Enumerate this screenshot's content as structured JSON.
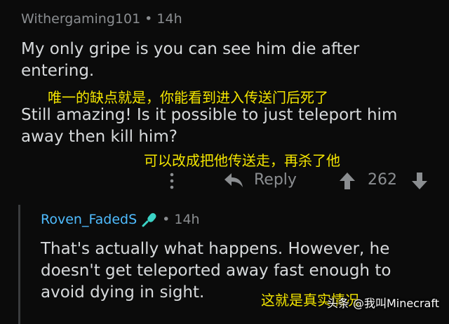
{
  "comment": {
    "author": "Withergaming101",
    "separator": "•",
    "time": "14h",
    "lines": [
      "My only gripe is you can see him die after",
      "entering.",
      "Still amazing! Is it possible to just teleport him",
      "away then kill him?"
    ],
    "overlay_1": "唯一的缺点就是，你能看到进入传送门后死了",
    "overlay_2": "可以改成把他传送走，再杀了他",
    "actions": {
      "reply_label": "Reply",
      "vote_count": "262"
    }
  },
  "reply": {
    "author": "Roven_FadedS",
    "separator": "•",
    "time": "14h",
    "lines": [
      "That's actually what happens. However, he",
      "doesn't get teleported away fast enough to",
      "avoid dying in sight."
    ],
    "overlay": "这就是真实情况"
  },
  "watermark": "头条 @我叫Minecraft",
  "colors": {
    "background": "#0b0b0b",
    "text": "#d7dadc",
    "meta": "#8b8e91",
    "author_link": "#4fbcff",
    "overlay": "#f3e500"
  }
}
